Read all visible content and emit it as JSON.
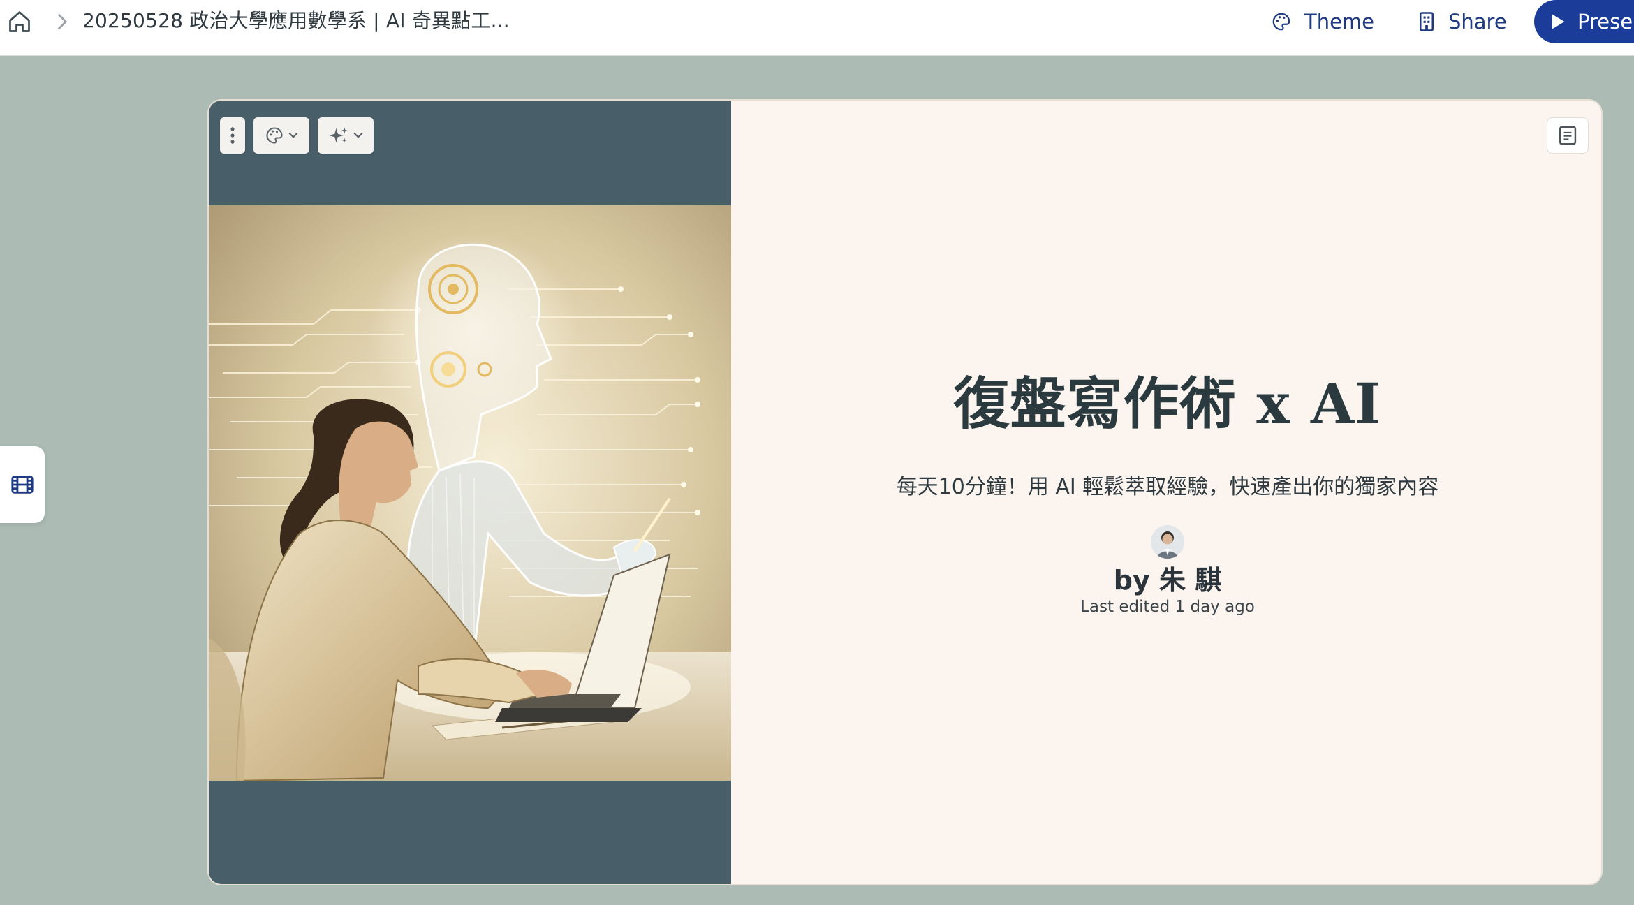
{
  "topbar": {
    "doc_title": "20250528 政治大學應用數學系 | AI 奇異點工...",
    "theme_label": "Theme",
    "share_label": "Share",
    "present_label": "Presen"
  },
  "card": {
    "title": "復盤寫作術 x AI",
    "subtitle": "每天10分鐘！用 AI 輕鬆萃取經驗，快速產出你的獨家內容",
    "author": "by 朱 騏",
    "last_edited": "Last edited 1 day ago"
  },
  "colors": {
    "background": "#acbcb5",
    "accent": "#1b3c99",
    "card_left_panel": "#485e68",
    "card_right_panel": "#fcf5ef"
  },
  "icons": {
    "home": "home-icon",
    "breadcrumb_sep": "chevron-right-icon",
    "theme": "palette-icon",
    "share": "building-icon",
    "present": "play-icon",
    "filmstrip": "film-icon",
    "more": "more-vertical-icon",
    "ai": "sparkles-icon",
    "notes": "notes-icon"
  }
}
